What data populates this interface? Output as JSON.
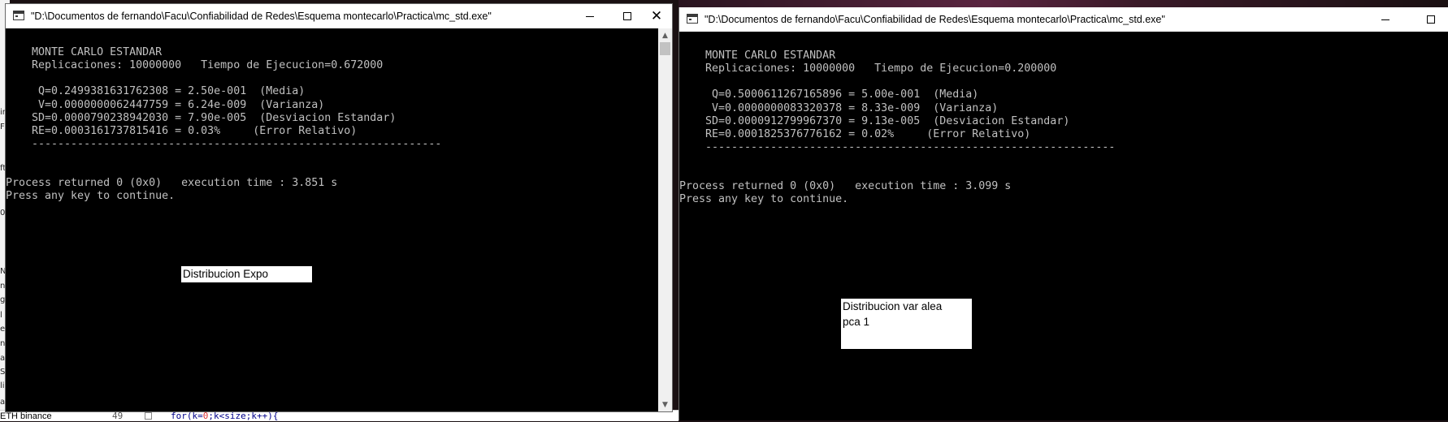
{
  "background": {
    "bottom_tab": "ETH binance",
    "code_line_number": "49",
    "code_line": {
      "prefix": "for(k=",
      "zero": "0",
      "suffix": ";k<size;k++){"
    },
    "left_fragments": [
      "in",
      "F",
      "ft",
      "0",
      "N",
      "n",
      "g",
      "l",
      "e",
      "n",
      "a",
      "S",
      "li",
      "a"
    ]
  },
  "windows": [
    {
      "id": "left",
      "title": "\"D:\\Documentos de fernando\\Facu\\Confiabilidad de Redes\\Esquema montecarlo\\Practica\\mc_std.exe\"",
      "buttons": {
        "minimize": "minimize",
        "maximize": "maximize",
        "close": "close"
      },
      "console_lines": [
        "",
        "    MONTE CARLO ESTANDAR",
        "    Replicaciones: 10000000   Tiempo de Ejecucion=0.672000",
        "",
        "     Q=0.2499381631762308 = 2.50e-001  (Media)",
        "     V=0.0000000062447759 = 6.24e-009  (Varianza)",
        "    SD=0.0000790238942030 = 7.90e-005  (Desviacion Estandar)",
        "    RE=0.0003161737815416 = 0.03%     (Error Relativo)",
        "    ---------------------------------------------------------------",
        "",
        "",
        "Process returned 0 (0x0)   execution time : 3.851 s",
        "Press any key to continue."
      ],
      "note": "Distribucion Expo"
    },
    {
      "id": "right",
      "title": "\"D:\\Documentos de fernando\\Facu\\Confiabilidad de Redes\\Esquema montecarlo\\Practica\\mc_std.exe\"",
      "buttons": {
        "minimize": "minimize",
        "maximize": "maximize"
      },
      "console_lines": [
        "",
        "    MONTE CARLO ESTANDAR",
        "    Replicaciones: 10000000   Tiempo de Ejecucion=0.200000",
        "",
        "     Q=0.5000611267165896 = 5.00e-001  (Media)",
        "     V=0.0000000083320378 = 8.33e-009  (Varianza)",
        "    SD=0.0000912799967370 = 9.13e-005  (Desviacion Estandar)",
        "    RE=0.0001825376776162 = 0.02%     (Error Relativo)",
        "    ---------------------------------------------------------------",
        "",
        "",
        "Process returned 0 (0x0)   execution time : 3.099 s",
        "Press any key to continue."
      ],
      "note": "Distribucion var alea\npca 1"
    }
  ],
  "colors": {
    "console_bg": "#000000",
    "console_text": "#c0c0c0",
    "titlebar_bg": "#ffffff"
  }
}
